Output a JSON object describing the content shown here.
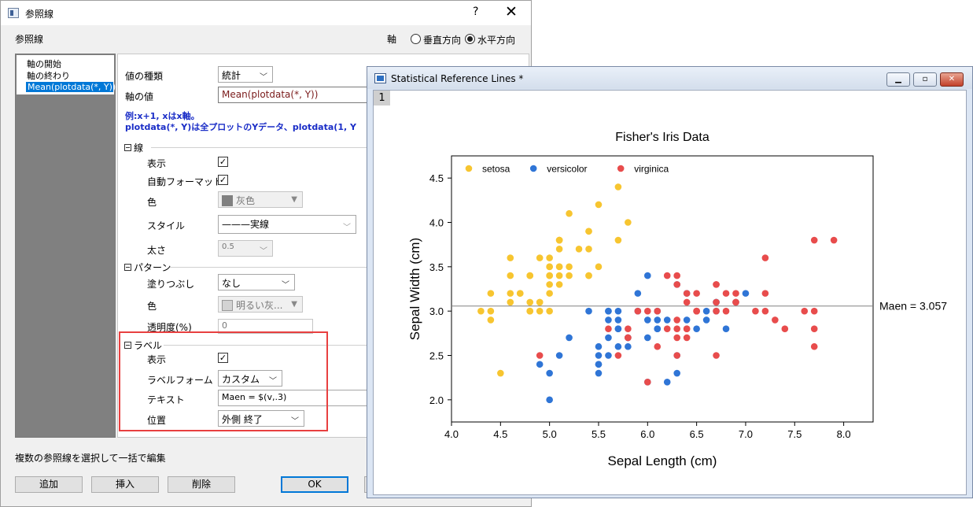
{
  "dialog": {
    "title": "参照線",
    "help": "?",
    "close": "✕",
    "group_label": "参照線",
    "axis_label": "軸",
    "axis_options": [
      "垂直方向",
      "水平方向"
    ],
    "axis_selected": "水平方向",
    "tree_items": [
      "軸の開始",
      "軸の終わり",
      "Mean(plotdata(*, Y))"
    ],
    "value_type_label": "値の種類",
    "value_type": "統計",
    "axis_value_label": "軸の値",
    "axis_value": "Mean(plotdata(*, Y))",
    "hint_line1": "例:x+1, xはx軸。",
    "hint_line2": "plotdata(*, Y)は全プロットのYデータ、plotdata(1, Y",
    "line_section": "線",
    "show_label": "表示",
    "auto_format_label": "自動フォーマット",
    "color_label": "色",
    "line_color": "灰色",
    "style_label": "スタイル",
    "line_style": "———実線",
    "width_label": "太さ",
    "line_width": "0.5",
    "pattern_section": "パターン",
    "fill_label": "塗りつぶし",
    "fill_value": "なし",
    "pattern_color": "明るい灰...",
    "transparency_label": "透明度(%)",
    "transparency": "0",
    "label_section": "ラベル",
    "label_form_label": "ラベルフォーム",
    "label_form": "カスタム",
    "text_label": "テキスト",
    "text_value": "Maen = $(v,.3)",
    "position_label": "位置",
    "position_value": "外側 終了",
    "batch_edit": "複数の参照線を選択して一括で編集",
    "buttons": [
      "追加",
      "挿入",
      "削除",
      "OK"
    ],
    "colors": {
      "selection": "#0078d7",
      "highlight_box": "#e84040",
      "gray_swatch": "#808080",
      "light_gray_swatch": "#d3d3d3"
    }
  },
  "graph_window": {
    "title": "Statistical Reference Lines *",
    "layer_label": "1",
    "buttons": [
      "minimize-icon",
      "restore-icon",
      "close-icon"
    ]
  },
  "chart_data": {
    "type": "scatter",
    "title": "Fisher's Iris Data",
    "xlabel": "Sepal Length (cm)",
    "ylabel": "Sepal Width (cm)",
    "xlim": [
      4.0,
      8.3
    ],
    "ylim": [
      1.75,
      4.75
    ],
    "xticks": [
      "4.0",
      "4.5",
      "5.0",
      "5.5",
      "6.0",
      "6.5",
      "7.0",
      "7.5",
      "8.0"
    ],
    "yticks": [
      "2.0",
      "2.5",
      "3.0",
      "3.5",
      "4.0",
      "4.5"
    ],
    "legend_position": "top-left",
    "reference_line": {
      "y": 3.057,
      "label": "Maen = 3.057",
      "color": "#808080"
    },
    "series": [
      {
        "name": "setosa",
        "color": "#f7c530",
        "x": [
          5.1,
          4.9,
          4.7,
          4.6,
          5.0,
          5.4,
          4.6,
          5.0,
          4.4,
          4.9,
          5.4,
          4.8,
          4.8,
          4.3,
          5.8,
          5.7,
          5.4,
          5.1,
          5.7,
          5.1,
          5.4,
          5.1,
          4.6,
          5.1,
          4.8,
          5.0,
          5.0,
          5.2,
          5.2,
          4.7,
          4.8,
          5.4,
          5.2,
          5.5,
          4.9,
          5.0,
          5.5,
          4.9,
          4.4,
          5.1,
          5.0,
          4.5,
          4.4,
          5.0,
          5.1,
          4.8,
          5.1,
          4.6,
          5.3,
          5.0
        ],
        "y": [
          3.5,
          3.0,
          3.2,
          3.1,
          3.6,
          3.9,
          3.4,
          3.4,
          2.9,
          3.1,
          3.7,
          3.4,
          3.0,
          3.0,
          4.0,
          4.4,
          3.9,
          3.5,
          3.8,
          3.8,
          3.4,
          3.7,
          3.6,
          3.3,
          3.4,
          3.0,
          3.4,
          3.5,
          3.4,
          3.2,
          3.1,
          3.4,
          4.1,
          4.2,
          3.1,
          3.2,
          3.5,
          3.6,
          3.0,
          3.4,
          3.5,
          2.3,
          3.2,
          3.5,
          3.8,
          3.0,
          3.8,
          3.2,
          3.7,
          3.3
        ]
      },
      {
        "name": "versicolor",
        "color": "#2f75d6",
        "x": [
          7.0,
          6.4,
          6.9,
          5.5,
          6.5,
          5.7,
          6.3,
          4.9,
          6.6,
          5.2,
          5.0,
          5.9,
          6.0,
          6.1,
          5.6,
          6.7,
          5.6,
          5.8,
          6.2,
          5.6,
          5.9,
          6.1,
          6.3,
          6.1,
          6.4,
          6.6,
          6.8,
          6.7,
          6.0,
          5.7,
          5.5,
          5.5,
          5.8,
          6.0,
          5.4,
          6.0,
          6.7,
          6.3,
          5.6,
          5.5,
          5.5,
          6.1,
          5.8,
          5.0,
          5.6,
          5.7,
          5.7,
          6.2,
          5.1,
          5.7
        ],
        "y": [
          3.2,
          3.2,
          3.1,
          2.3,
          2.8,
          2.8,
          3.3,
          2.4,
          2.9,
          2.7,
          2.0,
          3.0,
          2.2,
          2.9,
          2.9,
          3.1,
          3.0,
          2.7,
          2.2,
          2.5,
          3.2,
          2.8,
          2.5,
          2.8,
          2.9,
          3.0,
          2.8,
          3.0,
          2.9,
          2.6,
          2.4,
          2.4,
          2.7,
          2.7,
          3.0,
          3.4,
          3.1,
          2.3,
          3.0,
          2.5,
          2.6,
          3.0,
          2.6,
          2.3,
          2.7,
          3.0,
          2.9,
          2.9,
          2.5,
          2.8
        ]
      },
      {
        "name": "virginica",
        "color": "#e84c4c",
        "x": [
          6.3,
          5.8,
          7.1,
          6.3,
          6.5,
          7.6,
          4.9,
          7.3,
          6.7,
          7.2,
          6.5,
          6.4,
          6.8,
          5.7,
          5.8,
          6.4,
          6.5,
          7.7,
          7.7,
          6.0,
          6.9,
          5.6,
          7.7,
          6.3,
          6.7,
          7.2,
          6.2,
          6.1,
          6.4,
          7.2,
          7.4,
          7.9,
          6.4,
          6.3,
          6.1,
          7.7,
          6.3,
          6.4,
          6.0,
          6.9,
          6.7,
          6.9,
          5.8,
          6.8,
          6.7,
          6.7,
          6.3,
          6.5,
          6.2,
          5.9
        ],
        "y": [
          3.3,
          2.7,
          3.0,
          2.9,
          3.0,
          3.0,
          2.5,
          2.9,
          2.5,
          3.6,
          3.2,
          2.7,
          3.0,
          2.5,
          2.8,
          3.2,
          3.0,
          3.8,
          2.6,
          2.2,
          3.2,
          2.8,
          2.8,
          2.7,
          3.3,
          3.2,
          2.8,
          3.0,
          2.8,
          3.0,
          2.8,
          3.8,
          2.8,
          2.8,
          2.6,
          3.0,
          3.4,
          3.1,
          3.0,
          3.1,
          3.1,
          3.1,
          2.7,
          3.2,
          3.3,
          3.0,
          2.5,
          3.0,
          3.4,
          3.0
        ]
      }
    ]
  }
}
